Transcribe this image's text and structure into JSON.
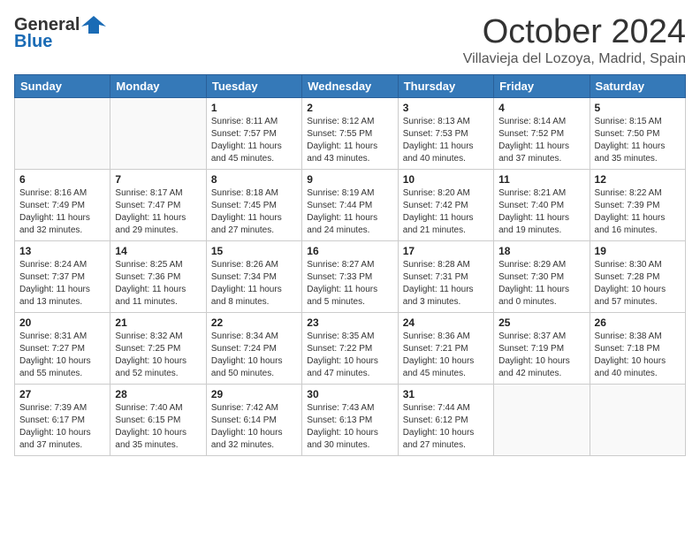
{
  "logo": {
    "line1": "General",
    "line2": "Blue"
  },
  "header": {
    "month": "October 2024",
    "location": "Villavieja del Lozoya, Madrid, Spain"
  },
  "weekdays": [
    "Sunday",
    "Monday",
    "Tuesday",
    "Wednesday",
    "Thursday",
    "Friday",
    "Saturday"
  ],
  "weeks": [
    [
      {
        "day": "",
        "info": ""
      },
      {
        "day": "",
        "info": ""
      },
      {
        "day": "1",
        "info": "Sunrise: 8:11 AM\nSunset: 7:57 PM\nDaylight: 11 hours and 45 minutes."
      },
      {
        "day": "2",
        "info": "Sunrise: 8:12 AM\nSunset: 7:55 PM\nDaylight: 11 hours and 43 minutes."
      },
      {
        "day": "3",
        "info": "Sunrise: 8:13 AM\nSunset: 7:53 PM\nDaylight: 11 hours and 40 minutes."
      },
      {
        "day": "4",
        "info": "Sunrise: 8:14 AM\nSunset: 7:52 PM\nDaylight: 11 hours and 37 minutes."
      },
      {
        "day": "5",
        "info": "Sunrise: 8:15 AM\nSunset: 7:50 PM\nDaylight: 11 hours and 35 minutes."
      }
    ],
    [
      {
        "day": "6",
        "info": "Sunrise: 8:16 AM\nSunset: 7:49 PM\nDaylight: 11 hours and 32 minutes."
      },
      {
        "day": "7",
        "info": "Sunrise: 8:17 AM\nSunset: 7:47 PM\nDaylight: 11 hours and 29 minutes."
      },
      {
        "day": "8",
        "info": "Sunrise: 8:18 AM\nSunset: 7:45 PM\nDaylight: 11 hours and 27 minutes."
      },
      {
        "day": "9",
        "info": "Sunrise: 8:19 AM\nSunset: 7:44 PM\nDaylight: 11 hours and 24 minutes."
      },
      {
        "day": "10",
        "info": "Sunrise: 8:20 AM\nSunset: 7:42 PM\nDaylight: 11 hours and 21 minutes."
      },
      {
        "day": "11",
        "info": "Sunrise: 8:21 AM\nSunset: 7:40 PM\nDaylight: 11 hours and 19 minutes."
      },
      {
        "day": "12",
        "info": "Sunrise: 8:22 AM\nSunset: 7:39 PM\nDaylight: 11 hours and 16 minutes."
      }
    ],
    [
      {
        "day": "13",
        "info": "Sunrise: 8:24 AM\nSunset: 7:37 PM\nDaylight: 11 hours and 13 minutes."
      },
      {
        "day": "14",
        "info": "Sunrise: 8:25 AM\nSunset: 7:36 PM\nDaylight: 11 hours and 11 minutes."
      },
      {
        "day": "15",
        "info": "Sunrise: 8:26 AM\nSunset: 7:34 PM\nDaylight: 11 hours and 8 minutes."
      },
      {
        "day": "16",
        "info": "Sunrise: 8:27 AM\nSunset: 7:33 PM\nDaylight: 11 hours and 5 minutes."
      },
      {
        "day": "17",
        "info": "Sunrise: 8:28 AM\nSunset: 7:31 PM\nDaylight: 11 hours and 3 minutes."
      },
      {
        "day": "18",
        "info": "Sunrise: 8:29 AM\nSunset: 7:30 PM\nDaylight: 11 hours and 0 minutes."
      },
      {
        "day": "19",
        "info": "Sunrise: 8:30 AM\nSunset: 7:28 PM\nDaylight: 10 hours and 57 minutes."
      }
    ],
    [
      {
        "day": "20",
        "info": "Sunrise: 8:31 AM\nSunset: 7:27 PM\nDaylight: 10 hours and 55 minutes."
      },
      {
        "day": "21",
        "info": "Sunrise: 8:32 AM\nSunset: 7:25 PM\nDaylight: 10 hours and 52 minutes."
      },
      {
        "day": "22",
        "info": "Sunrise: 8:34 AM\nSunset: 7:24 PM\nDaylight: 10 hours and 50 minutes."
      },
      {
        "day": "23",
        "info": "Sunrise: 8:35 AM\nSunset: 7:22 PM\nDaylight: 10 hours and 47 minutes."
      },
      {
        "day": "24",
        "info": "Sunrise: 8:36 AM\nSunset: 7:21 PM\nDaylight: 10 hours and 45 minutes."
      },
      {
        "day": "25",
        "info": "Sunrise: 8:37 AM\nSunset: 7:19 PM\nDaylight: 10 hours and 42 minutes."
      },
      {
        "day": "26",
        "info": "Sunrise: 8:38 AM\nSunset: 7:18 PM\nDaylight: 10 hours and 40 minutes."
      }
    ],
    [
      {
        "day": "27",
        "info": "Sunrise: 7:39 AM\nSunset: 6:17 PM\nDaylight: 10 hours and 37 minutes."
      },
      {
        "day": "28",
        "info": "Sunrise: 7:40 AM\nSunset: 6:15 PM\nDaylight: 10 hours and 35 minutes."
      },
      {
        "day": "29",
        "info": "Sunrise: 7:42 AM\nSunset: 6:14 PM\nDaylight: 10 hours and 32 minutes."
      },
      {
        "day": "30",
        "info": "Sunrise: 7:43 AM\nSunset: 6:13 PM\nDaylight: 10 hours and 30 minutes."
      },
      {
        "day": "31",
        "info": "Sunrise: 7:44 AM\nSunset: 6:12 PM\nDaylight: 10 hours and 27 minutes."
      },
      {
        "day": "",
        "info": ""
      },
      {
        "day": "",
        "info": ""
      }
    ]
  ]
}
